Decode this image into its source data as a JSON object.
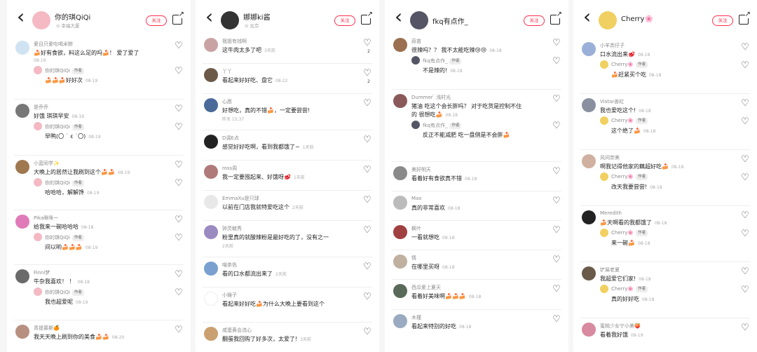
{
  "ui": {
    "follow_label": "关注",
    "author_tag": "作者"
  },
  "panels": [
    {
      "header": {
        "name": "你的琪QiQi",
        "sub": "⊙ 幸福大厦"
      },
      "avatar_color": "#f4b9c2",
      "comments": [
        {
          "user": "爱且只爱吃喝米粽",
          "text": "🍰好有食欲，料这么足的吗🍰！ 爱了爱了",
          "time": "08-19",
          "time_newline": true,
          "avatar_color": "#cfe3f3",
          "reply": {
            "user": "你的琪QiQi",
            "text": "🍰🍰🍰好好次",
            "time": "08-19"
          }
        },
        {
          "user": "是乔乔",
          "text": "好饿 琪琪早安",
          "time": "08-19",
          "avatar_color": "#777",
          "reply": {
            "user": "你的琪QiQi",
            "text": "早鸭(〇 ˙ ε ˙〇)",
            "time": "08-19"
          }
        },
        {
          "user": "小蓝同学✨",
          "text": "大晚上的居然让我刷到这个🍰🍰",
          "time": "08-19",
          "avatar_color": "#a07850",
          "reply": {
            "user": "你的琪QiQi",
            "text": "哈哈哈，解解馋",
            "time": "08-19"
          }
        },
        {
          "user": "Pika啾咪ー",
          "text": "给我来一碗哈哈哈",
          "time": "08-18",
          "avatar_color": "#e07ab8",
          "reply": {
            "user": "你的琪QiQi",
            "text": "间以哟🍰🍰🍰",
            "time": "08-19"
          }
        },
        {
          "user": "Finni梦",
          "text": "牛杂我喜欢！ ！",
          "time": "08-18",
          "avatar_color": "#6a6a6a",
          "reply": {
            "user": "你的琪QiQi",
            "text": "我也超爱呢",
            "time": "08-19"
          }
        },
        {
          "user": "青提慕斯🍊",
          "text": "我天天晚上刷到你的美食🍰🍰",
          "time": "08-20",
          "avatar_color": "#b89080"
        }
      ]
    },
    {
      "header": {
        "name": "娜娜ki酱",
        "sub": "⊙ 北京"
      },
      "avatar_color": "#333",
      "comments": [
        {
          "user": "我姐有钱啊",
          "text": "这牛肉太多了吧",
          "time": "3天前",
          "likes": "2",
          "avatar_color": "#c9a3a3"
        },
        {
          "user": "丫丫",
          "text": "看起来好好吃、盘它",
          "time": "08-22",
          "likes": "2",
          "avatar_color": "#6b5a48"
        },
        {
          "user": "心愿",
          "text": "好想吃，真的不错🍰，一定要尝尝!",
          "time": "昨天 15:37",
          "time_newline": true,
          "avatar_color": "#4a6a9a"
        },
        {
          "user": "D调E点",
          "text": "感觉好好吃啊，看到我都饿了~",
          "time": "1天前",
          "avatar_color": "#222"
        },
        {
          "user": "ross周",
          "text": "我一定要囤起来、好饿呀🥩",
          "time": "1天前",
          "avatar_color": "#b07a7a"
        },
        {
          "user": "EmmaXu是只球",
          "text": "以前在门店我就特爱吃这个",
          "time": "2天前",
          "avatar_color": "#e8e8e8"
        },
        {
          "user": "钟灵毓秀",
          "text": "粉里真的就酸辣粉是最好吃的了，没有之一",
          "time": "2天前",
          "time_newline": true,
          "avatar_color": "#9a8ac0"
        },
        {
          "user": "喵茶色",
          "text": "看的口水都流出来了",
          "time": "2天前",
          "avatar_color": "#7aa0d0"
        },
        {
          "user": "小猴子",
          "text": "看起来好好吃🍰为什么大晚上要看到这个",
          "time": "",
          "avatar_color": "#fff"
        },
        {
          "user": "咸蛋黄会流心",
          "text": "翻蛋我回购了好多次，太爱了!",
          "time": "3天前",
          "avatar_color": "#caa070"
        }
      ]
    },
    {
      "header": {
        "name": "fkq有点作_",
        "sub": ""
      },
      "avatar_color": "#556",
      "comments": [
        {
          "user": "蒜苗",
          "text": "很辣吗？？ 我不太能吃辣😢😢",
          "time": "08-18",
          "avatar_color": "#9a7050",
          "reply": {
            "user": "fkq有点作_",
            "tag": true,
            "text": "不是辣的!",
            "time": "08-18"
          }
        },
        {
          "user": "Dummer ̈  浅时光",
          "text": "猪油 吃这个会长胖吗？ 对于吃货是控制不住",
          "text2": "的 很想吃🍰",
          "time": "08-18",
          "avatar_color": "#8a5a5a",
          "reply": {
            "user": "fkq有点作_",
            "tag": true,
            "text": "反正不能减肥 吃一盘侧是不会胖🍰",
            "time": ""
          }
        },
        {
          "user": "美好明天",
          "text": "看着好有食欲真不错",
          "time": "08-18",
          "avatar_color": "#8a8a8a"
        },
        {
          "user": "Max",
          "text": "真的非常喜欢",
          "time": "08-18",
          "avatar_color": "#bbb"
        },
        {
          "user": "枫叶",
          "text": "一看就想吃",
          "time": "08-18",
          "avatar_color": "#a04040"
        },
        {
          "user": "情",
          "text": "在哪里买呀",
          "time": "08-18",
          "avatar_color": "#c0b0a0"
        },
        {
          "user": "西瓜爱上夏天",
          "text": "看着好美味啊🍰🍰🍰",
          "time": "08-18",
          "avatar_color": "#5a6a5a"
        },
        {
          "user": "木槿",
          "text": "看起来特别的好吃",
          "time": "08-18",
          "avatar_color": "#9aaac0"
        }
      ]
    },
    {
      "header": {
        "name": "Cherry🌸",
        "sub": ""
      },
      "avatar_color": "#f0d060",
      "comments": [
        {
          "user": "小羊羔仔子",
          "text": "口水流出来🥩",
          "time": "08-18",
          "avatar_color": "#9ab0d8",
          "reply": {
            "user": "Cherry🌸",
            "tag": true,
            "text": "🍰赶紧买个吃",
            "time": "08-18"
          }
        },
        {
          "user": "Vistar善虹",
          "text": "我也爱吃这个!",
          "time": "08-18",
          "avatar_color": "#8a90a0",
          "reply": {
            "user": "Cherry🌸",
            "tag": true,
            "text": "这个绝了🍰",
            "time": "08-18"
          }
        },
        {
          "user": "风间奈美",
          "text": "啊我记得他家的藕超好吃🍰",
          "time": "08-18",
          "avatar_color": "#d0b0a0",
          "reply": {
            "user": "Cherry🌸",
            "tag": true,
            "text": "改天我要尝尝!",
            "time": "08-18"
          }
        },
        {
          "user": "Meredith",
          "text": "🍰天啊看的我都饿了",
          "time": "08-18",
          "avatar_color": "#222",
          "reply": {
            "user": "Cherry🌸",
            "tag": true,
            "text": "来一碗🍰",
            "time": "08-18"
          }
        },
        {
          "user": "铲屎老夏",
          "text": "我超爱它们家!",
          "time": "08-18",
          "avatar_color": "#6a5a4a",
          "reply": {
            "user": "Cherry🌸",
            "tag": true,
            "text": "真的好好吃",
            "time": "08-18"
          }
        },
        {
          "user": "蜜桃少女宁小美🍑",
          "text": "看着我好饿",
          "time": "08-19",
          "avatar_color": "#d88aa0"
        }
      ]
    }
  ]
}
